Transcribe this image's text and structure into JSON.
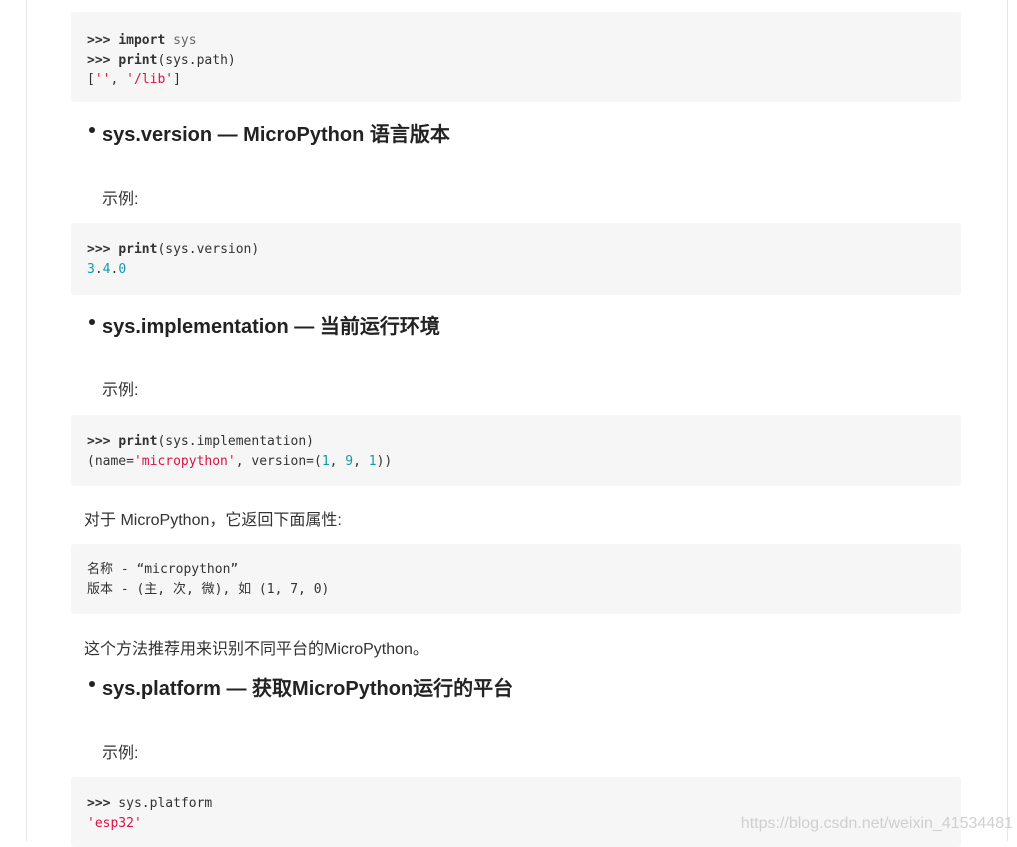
{
  "block1": {
    "l1": {
      "prompt": ">>>",
      "kw": "import",
      "rest": " sys"
    },
    "l2": {
      "prompt": ">>>",
      "kw": "print",
      "rest": "(sys.path)"
    },
    "l3": {
      "open": "[",
      "s1": "''",
      "sep": ", ",
      "s2": "'/lib'",
      "close": "]"
    }
  },
  "h_version": "sys.version — MicroPython 语言版本",
  "example1": "示例:",
  "block2": {
    "l1": {
      "prompt": ">>>",
      "kw": "print",
      "rest": "(sys.version)"
    },
    "l2": {
      "a": "3",
      "d1": ".",
      "b": "4",
      "d2": ".",
      "c": "0"
    }
  },
  "h_impl": "sys.implementation — 当前运行环境",
  "example2": "示例:",
  "block3": {
    "l1": {
      "prompt": ">>>",
      "kw": "print",
      "rest": "(sys.implementation)"
    },
    "l2": {
      "p1": "(name=",
      "s": "'micropython'",
      "p2": ", version=(",
      "n1": "1",
      "c1": ", ",
      "n2": "9",
      "c2": ", ",
      "n3": "1",
      "p3": "))"
    }
  },
  "para_impl": "对于 MicroPython，它返回下面属性:",
  "block4": {
    "l1": "名称 - “micropython”",
    "l2": "版本 - (主, 次, 微), 如 (1, 7, 0)"
  },
  "para_recommend": "这个方法推荐用来识别不同平台的MicroPython。",
  "h_platform": "sys.platform — 获取MicroPython运行的平台",
  "example3": "示例:",
  "block5": {
    "l1": {
      "prompt": ">>>",
      "rest": " sys.platform"
    },
    "l2": "'esp32'"
  },
  "watermark": "https://blog.csdn.net/weixin_41534481"
}
